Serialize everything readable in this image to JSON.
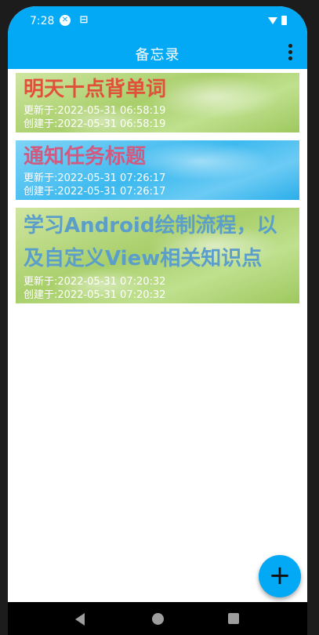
{
  "status": {
    "time": "7:28",
    "icons": [
      "close-circle-icon",
      "sim-icon",
      "wifi-icon",
      "battery-icon"
    ]
  },
  "appbar": {
    "title": "备忘录",
    "menu_icon": "more-vert-icon"
  },
  "notes": [
    {
      "title": "明天十点背单词",
      "title_color": "#e0503a",
      "background": "green",
      "updated": "更新于:2022-05-31 06:58:19",
      "created": "创建于:2022-05-31 06:58:19"
    },
    {
      "title": "通知任务标题",
      "title_color": "#d05a80",
      "background": "blue",
      "updated": "更新于:2022-05-31 07:26:17",
      "created": "创建于:2022-05-31 07:26:17"
    },
    {
      "title": "学习Android绘制流程，以及自定义View相关知识点",
      "title_color": "#5a9ec9",
      "background": "green",
      "updated": "更新于:2022-05-31 07:20:32",
      "created": "创建于:2022-05-31 07:20:32"
    }
  ],
  "fab": {
    "label": "+",
    "icon": "add-icon"
  },
  "navbar": {
    "icons": [
      "back-icon",
      "home-icon",
      "recents-icon"
    ]
  },
  "colors": {
    "primary": "#03a9f4"
  }
}
